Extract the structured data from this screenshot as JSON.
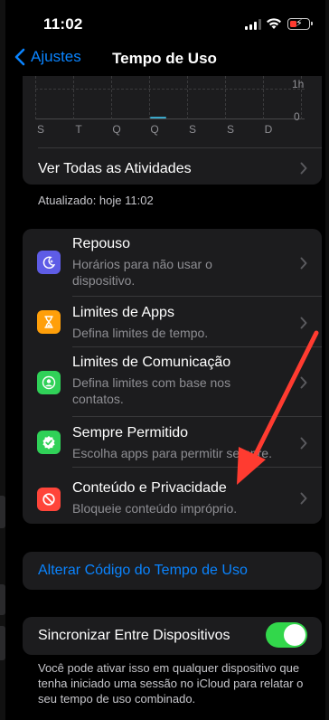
{
  "status_bar": {
    "time": "11:02"
  },
  "nav": {
    "back_label": "Ajustes",
    "title": "Tempo de Uso"
  },
  "chart_data": {
    "type": "bar",
    "categories": [
      "S",
      "T",
      "Q",
      "Q",
      "S",
      "S",
      "D"
    ],
    "values": [
      0,
      0,
      0,
      0.01,
      0,
      0,
      0
    ],
    "y_tick_labels": [
      "1h",
      "0"
    ],
    "ylim": [
      0,
      1
    ]
  },
  "chart_row": {
    "label": "Ver Todas as Atividades"
  },
  "updated": "Atualizado: hoje 11:02",
  "settings_list": [
    {
      "title": "Repouso",
      "subtitle": "Horários para não usar o dispositivo.",
      "icon": "moon-icon",
      "color": "#5e5ce6"
    },
    {
      "title": "Limites de Apps",
      "subtitle": "Defina limites de tempo.",
      "icon": "hourglass-icon",
      "color": "#ff9f0a"
    },
    {
      "title": "Limites de Comunicação",
      "subtitle": "Defina limites com base nos contatos.",
      "icon": "person-icon",
      "color": "#30d158"
    },
    {
      "title": "Sempre Permitido",
      "subtitle": "Escolha apps para permitir sempre.",
      "icon": "checkmark-seal-icon",
      "color": "#30d158"
    },
    {
      "title": "Conteúdo e Privacidade",
      "subtitle": "Bloqueie conteúdo impróprio.",
      "icon": "no-entry-icon",
      "color": "#ff453a"
    }
  ],
  "change_code": {
    "label": "Alterar Código do Tempo de Uso"
  },
  "sync": {
    "label": "Sincronizar Entre Dispositivos",
    "enabled": true
  },
  "footer_note": "Você pode ativar isso em qualquer dispositivo que tenha iniciado uma sessão no iCloud para relatar o seu tempo de uso combinado.",
  "colors": {
    "accent": "#0a84ff",
    "toggle_on": "#32d74b",
    "arrow": "#ff3b30"
  }
}
